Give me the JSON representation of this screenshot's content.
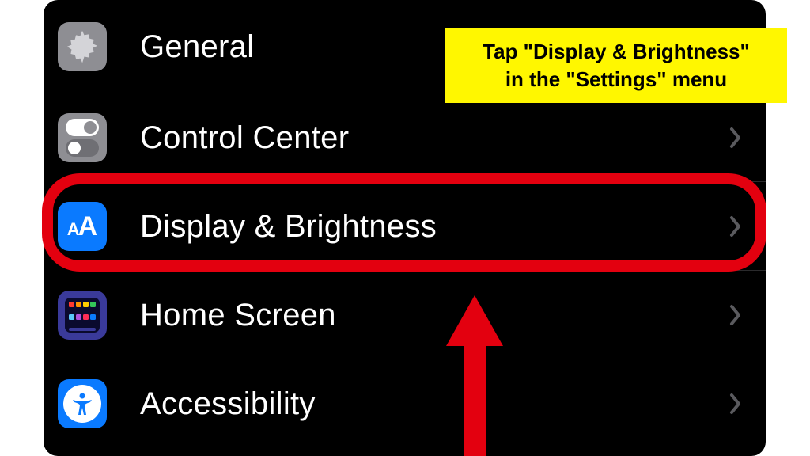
{
  "callout": {
    "line1": "Tap \"Display & Brightness\"",
    "line2": "in the \"Settings\" menu"
  },
  "settings": {
    "rows": [
      {
        "label": "General"
      },
      {
        "label": "Control Center"
      },
      {
        "label": "Display & Brightness"
      },
      {
        "label": "Home Screen"
      },
      {
        "label": "Accessibility"
      }
    ]
  },
  "icons": {
    "display_small": "A",
    "display_big": "A"
  },
  "colors": {
    "accent_blue": "#0a7aff",
    "gray_tile": "#8e8e93",
    "home_tile": "#3a3a9a",
    "annotation_red": "#e3000f",
    "callout_yellow": "#fff700"
  },
  "home_grid_colors": [
    [
      "#ff3b30",
      "#ff9500",
      "#ffcc00",
      "#34c759"
    ],
    [
      "#5ac8fa",
      "#af52de",
      "#ff2d55",
      "#0a7aff"
    ]
  ]
}
